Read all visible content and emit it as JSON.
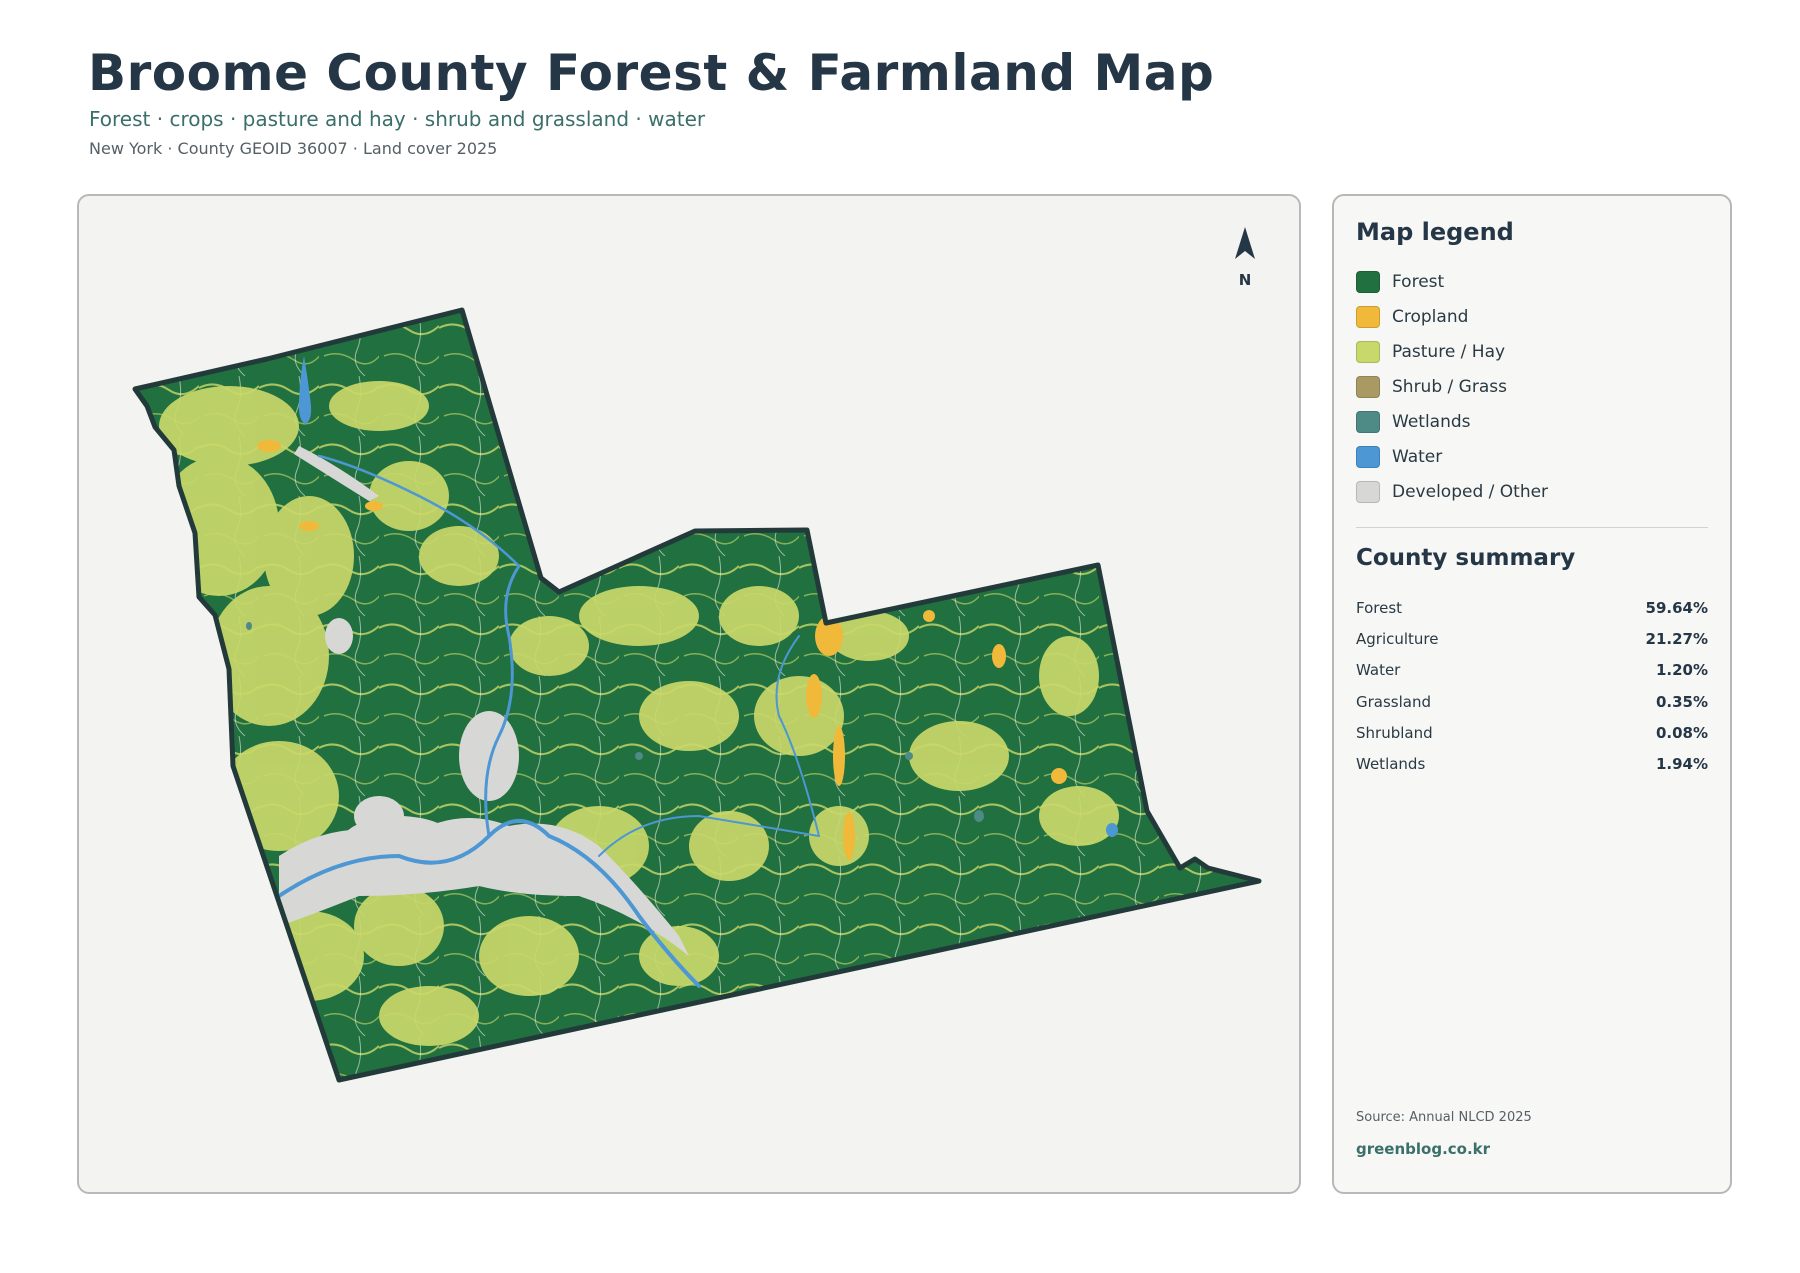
{
  "header": {
    "title": "Broome County Forest & Farmland Map",
    "subtitle": "Forest · crops · pasture and hay · shrub and grassland · water",
    "meta": "New York · County GEOID 36007 · Land cover 2025"
  },
  "map": {
    "north_label": "N",
    "compass_icon": "north-arrow-icon",
    "colors": {
      "forest": "#21703f",
      "cropland": "#f0b93a",
      "pasture": "#c9d86a",
      "shrub": "#a99a64",
      "wetlands": "#4e8b86",
      "water": "#4c97d4",
      "developed": "#d7d8d5",
      "border": "#223b3a"
    }
  },
  "legend": {
    "title": "Map legend",
    "items": [
      {
        "label": "Forest",
        "color": "#21703f"
      },
      {
        "label": "Cropland",
        "color": "#f0b93a"
      },
      {
        "label": "Pasture / Hay",
        "color": "#c9d86a"
      },
      {
        "label": "Shrub / Grass",
        "color": "#a99a64"
      },
      {
        "label": "Wetlands",
        "color": "#4e8b86"
      },
      {
        "label": "Water",
        "color": "#4c97d4"
      },
      {
        "label": "Developed / Other",
        "color": "#d7d8d5"
      }
    ]
  },
  "summary": {
    "title": "County summary",
    "rows": [
      {
        "name": "Forest",
        "value": "59.64%"
      },
      {
        "name": "Agriculture",
        "value": "21.27%"
      },
      {
        "name": "Water",
        "value": "1.20%"
      },
      {
        "name": "Grassland",
        "value": "0.35%"
      },
      {
        "name": "Shrubland",
        "value": "0.08%"
      },
      {
        "name": "Wetlands",
        "value": "1.94%"
      }
    ],
    "source": "Source: Annual NLCD 2025",
    "site": "greenblog.co.kr"
  }
}
